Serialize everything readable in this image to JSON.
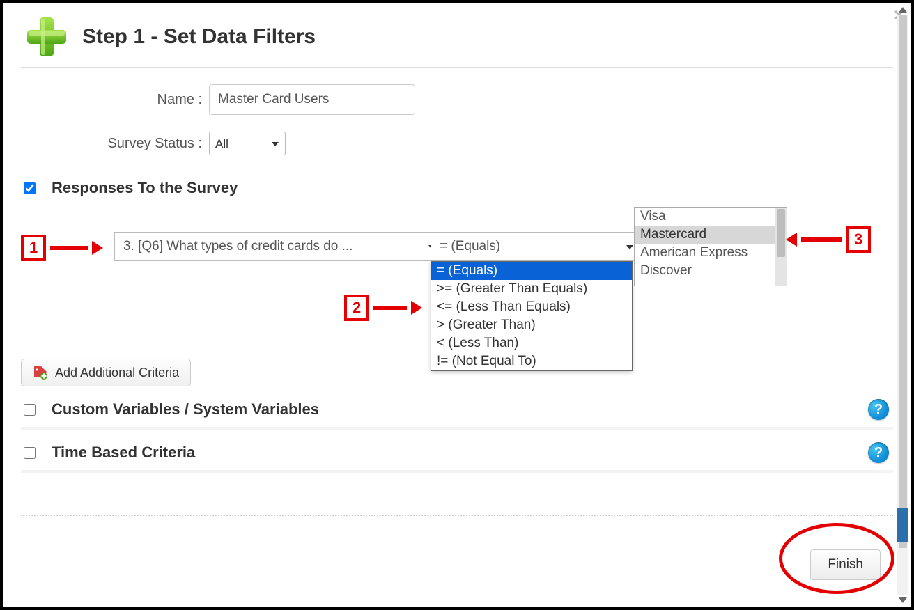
{
  "title": "Step 1 - Set Data Filters",
  "form": {
    "name_label": "Name :",
    "name_value": "Master Card Users",
    "status_label": "Survey Status :",
    "status_value": "All"
  },
  "sections": {
    "responses": "Responses To the Survey",
    "custom_vars": "Custom Variables / System Variables",
    "time_based": "Time Based Criteria"
  },
  "criteria": {
    "question_text": "3. [Q6] What types of credit cards do ...",
    "operator_selected": "= (Equals)",
    "operator_options": [
      "= (Equals)",
      ">= (Greater Than Equals)",
      "<= (Less Than Equals)",
      "> (Greater Than)",
      "< (Less Than)",
      "!= (Not Equal To)"
    ],
    "value_options": [
      "Visa",
      "Mastercard",
      "American Express",
      "Discover"
    ],
    "value_selected_index": 1
  },
  "callouts": {
    "one": "1",
    "two": "2",
    "three": "3"
  },
  "buttons": {
    "add_criteria": "Add Additional Criteria",
    "finish": "Finish"
  },
  "help_glyph": "?",
  "close_glyph": "×"
}
